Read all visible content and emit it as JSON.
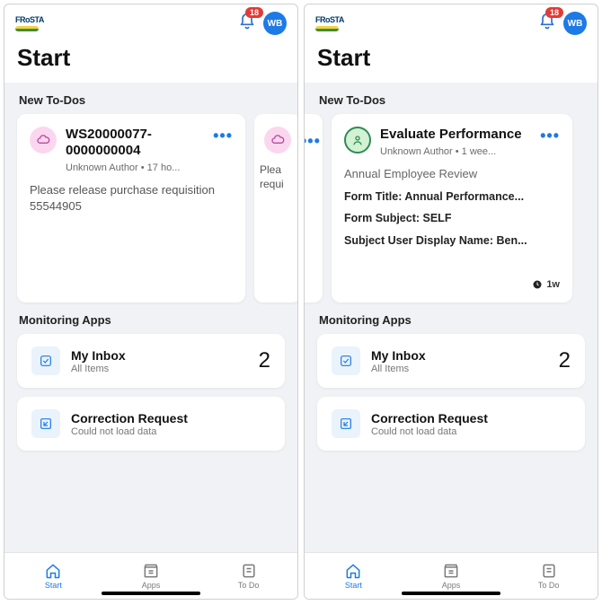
{
  "header": {
    "brand": "FRoSTA",
    "notif_count": "18",
    "avatar_initials": "WB"
  },
  "page_title": "Start",
  "sections": {
    "todos_title": "New To-Dos",
    "apps_title": "Monitoring Apps"
  },
  "left_screen": {
    "card1": {
      "title": "WS20000077-0000000004",
      "subtitle": "Unknown Author • 17 ho...",
      "body": "Please release purchase requisition 55544905"
    },
    "peek": {
      "title": "",
      "body": "Plea requi"
    }
  },
  "right_screen": {
    "card1": {
      "title": "Evaluate Performance",
      "subtitle": "Unknown Author • 1 wee...",
      "line0": "Annual Employee Review",
      "line1": "Form Title: Annual Performance...",
      "line2": "Form Subject: SELF",
      "line3": "Subject User Display Name: Ben...",
      "age": "1w"
    }
  },
  "apps": {
    "inbox": {
      "name": "My Inbox",
      "sub": "All Items",
      "count": "2"
    },
    "corr": {
      "name": "Correction Request",
      "sub": "Could not load data"
    }
  },
  "nav": {
    "start": "Start",
    "apps": "Apps",
    "todo": "To Do"
  }
}
